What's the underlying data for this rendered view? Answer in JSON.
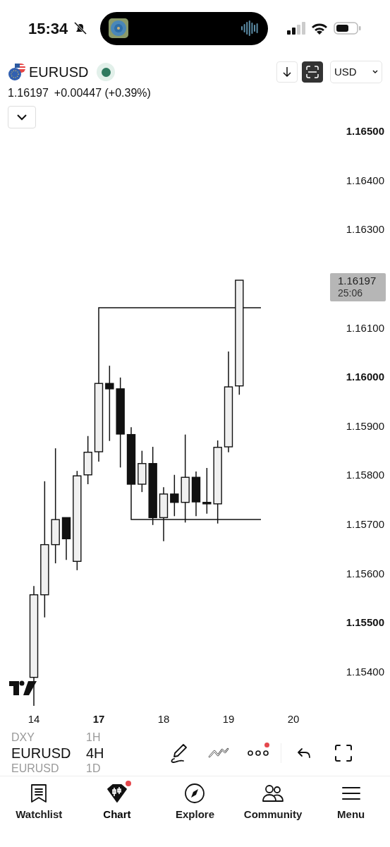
{
  "status_bar": {
    "time": "15:34",
    "muted": true
  },
  "header": {
    "symbol": "EURUSD",
    "price": "1.16197",
    "change": "+0.00447 (+0.39%)",
    "tools": [
      {
        "kind": "arrow-down",
        "on": false
      },
      {
        "kind": "autoscale",
        "on": true
      }
    ],
    "currency": "USD"
  },
  "chart": {
    "last_price": "1.16197",
    "countdown": "25:06",
    "price_labels": [
      {
        "label": "1.16500",
        "bold": true
      },
      {
        "label": "1.16400",
        "bold": false
      },
      {
        "label": "1.16300",
        "bold": false
      },
      {
        "label": "1.16100",
        "bold": false
      },
      {
        "label": "1.16000",
        "bold": true
      },
      {
        "label": "1.15900",
        "bold": false
      },
      {
        "label": "1.15800",
        "bold": false
      },
      {
        "label": "1.15700",
        "bold": false
      },
      {
        "label": "1.15600",
        "bold": false
      },
      {
        "label": "1.15500",
        "bold": true
      },
      {
        "label": "1.15400",
        "bold": false
      }
    ],
    "date_labels": [
      {
        "label": "14",
        "bold": false
      },
      {
        "label": "17",
        "bold": true
      },
      {
        "label": "18",
        "bold": false
      },
      {
        "label": "19",
        "bold": false
      },
      {
        "label": "20",
        "bold": false
      }
    ]
  },
  "toolbar": {
    "symbols": [
      {
        "label": "DXY",
        "selected": false
      },
      {
        "label": "EURUSD",
        "selected": true
      },
      {
        "label": "EURUSD",
        "selected": false
      }
    ],
    "intervals": [
      {
        "label": "1H",
        "selected": false
      },
      {
        "label": "4H",
        "selected": true
      },
      {
        "label": "1D",
        "selected": false
      }
    ],
    "tools": [
      {
        "kind": "brush",
        "badge": false
      },
      {
        "kind": "trend",
        "badge": false
      },
      {
        "kind": "more",
        "badge": true
      },
      {
        "kind": "undo",
        "badge": false
      },
      {
        "kind": "fullscreen",
        "badge": false
      }
    ]
  },
  "tab_bar": [
    {
      "kind": "watchlist",
      "label": "Watchlist",
      "selected": false,
      "badge": false
    },
    {
      "kind": "chart",
      "label": "Chart",
      "selected": true,
      "badge": true
    },
    {
      "kind": "explore",
      "label": "Explore",
      "selected": false,
      "badge": false
    },
    {
      "kind": "community",
      "label": "Community",
      "selected": false,
      "badge": false
    },
    {
      "kind": "menu",
      "label": "Menu",
      "selected": false,
      "badge": false
    }
  ]
}
